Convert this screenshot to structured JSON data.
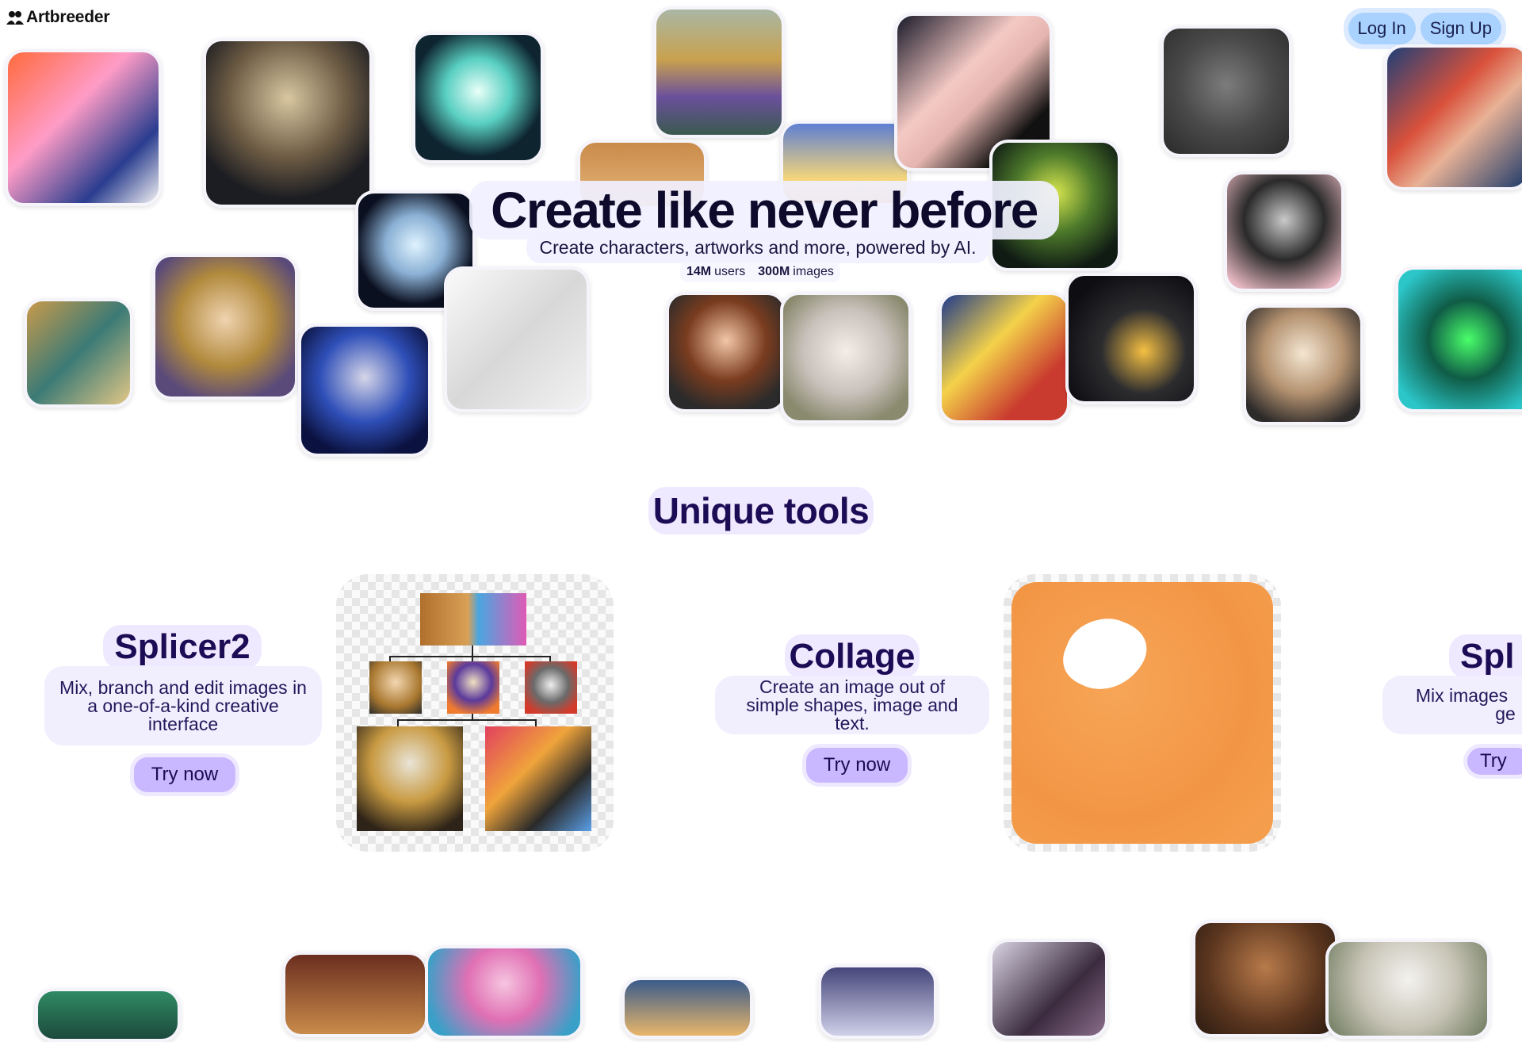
{
  "brand": {
    "name": "Artbreeder",
    "icon": "people-icon"
  },
  "auth": {
    "login_label": "Log In",
    "signup_label": "Sign Up"
  },
  "hero": {
    "title": "Create like never before",
    "subtitle": "Create characters, artworks and more, powered by AI.",
    "stats": {
      "users_count": "14M",
      "users_label": "users",
      "images_count": "300M",
      "images_label": "images"
    }
  },
  "section": {
    "title": "Unique tools"
  },
  "tools": [
    {
      "name": "Splicer2",
      "description": "Mix, branch and edit images in a one-of-a-kind creative interface",
      "cta": "Try now"
    },
    {
      "name": "Collage",
      "description": "Create an image out of simple shapes, image and text.",
      "cta": "Try now"
    },
    {
      "name": "Spl",
      "description_line1": "Mix images",
      "description_line2": "ge",
      "cta": "Try"
    }
  ],
  "colors": {
    "accent": "#c9b8ff",
    "title": "#1c0c55",
    "auth_button": "#a9d2ff",
    "collage_orange": "#f5a04f"
  }
}
